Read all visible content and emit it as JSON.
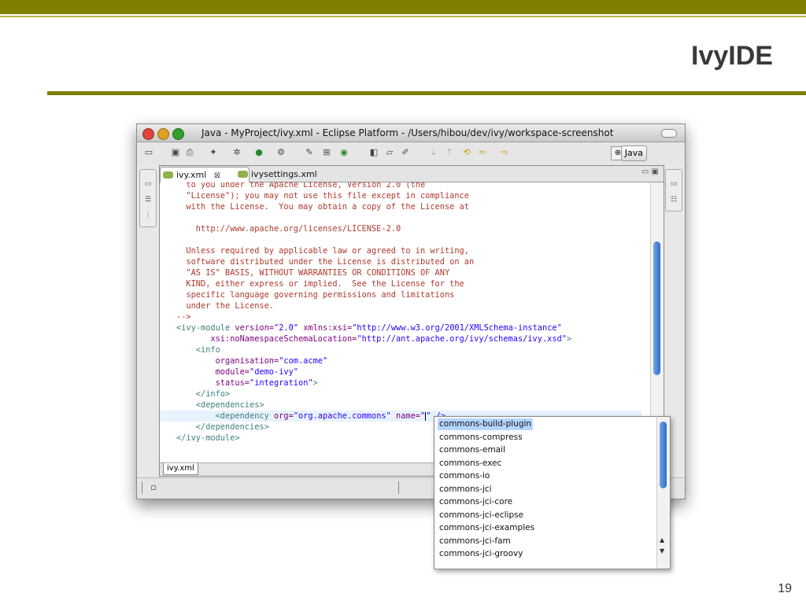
{
  "slide": {
    "title": "IvyIDE",
    "page_number": "19"
  },
  "window": {
    "title": "Java - MyProject/ivy.xml - Eclipse Platform - /Users/hibou/dev/ivy/workspace-screenshot",
    "perspective_label": "Java"
  },
  "editor": {
    "tabs": [
      {
        "label": "ivy.xml",
        "close": "⊠"
      },
      {
        "label": "ivysettings.xml"
      }
    ],
    "bottom_tab": "ivy.xml",
    "lines": [
      {
        "text": "  to you under the Apache License, Version 2.0 (the"
      },
      {
        "text": "  \"License\"); you may not use this file except in compliance"
      },
      {
        "text": "  with the License.  You may obtain a copy of the License at"
      },
      {
        "text": ""
      },
      {
        "text": "    http://www.apache.org/licenses/LICENSE-2.0"
      },
      {
        "text": ""
      },
      {
        "text": "  Unless required by applicable law or agreed to in writing,"
      },
      {
        "text": "  software distributed under the License is distributed on an"
      },
      {
        "text": "  \"AS IS\" BASIS, WITHOUT WARRANTIES OR CONDITIONS OF ANY"
      },
      {
        "text": "  KIND, either express or implied.  See the License for the"
      },
      {
        "text": "  specific language governing permissions and limitations"
      },
      {
        "text": "  under the License."
      },
      {
        "text": "-->"
      }
    ],
    "xml": {
      "l14a": "<ivy-module ",
      "l14b": "version=",
      "l14c": "\"2.0\"",
      "l14d": " xmlns:xsi=",
      "l14e": "\"http://www.w3.org/2001/XMLSchema-instance\"",
      "l15a": "       xsi:noNamespaceSchemaLocation=",
      "l15b": "\"http://ant.apache.org/ivy/schemas/ivy.xsd\"",
      "l15c": ">",
      "l16": "    <info",
      "l17a": "        organisation=",
      "l17b": "\"com.acme\"",
      "l18a": "        module=",
      "l18b": "\"demo-ivy\"",
      "l19a": "        status=",
      "l19b": "\"integration\"",
      "l19c": ">",
      "l20": "    </info>",
      "l21": "    <dependencies>",
      "l22a": "        <dependency ",
      "l22b": "org=",
      "l22c": "\"org.apache.commons\"",
      "l22d": " name=",
      "l22e": "\"",
      "l22f": "\" />",
      "l23": "    </dependencies>",
      "l24": "</ivy-module>"
    }
  },
  "completion": {
    "items": [
      "commons-build-plugin",
      "commons-compress",
      "commons-email",
      "commons-exec",
      "commons-io",
      "commons-jci",
      "commons-jci-core",
      "commons-jci-eclipse",
      "commons-jci-examples",
      "commons-jci-fam",
      "commons-jci-groovy"
    ],
    "selected": "commons-build-plugin"
  },
  "colors": {
    "accent_olive": "#7f7f00",
    "comment": "#b03a2e",
    "tag": "#3f7f7f",
    "attr": "#7f007f",
    "value": "#2a00ff"
  }
}
